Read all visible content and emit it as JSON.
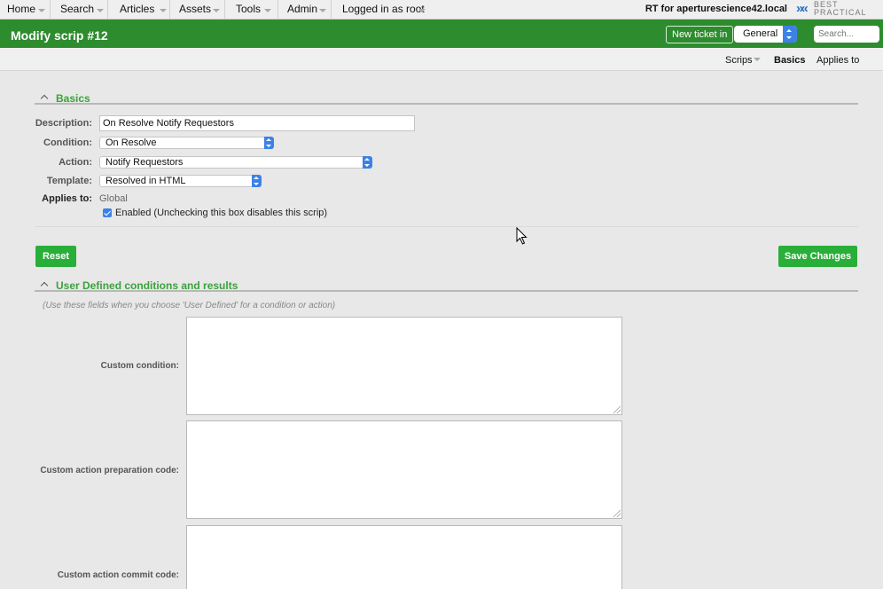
{
  "topbar": {
    "menu": [
      {
        "label": "Home"
      },
      {
        "label": "Search"
      },
      {
        "label": "Articles"
      },
      {
        "label": "Assets"
      },
      {
        "label": "Tools"
      },
      {
        "label": "Admin"
      },
      {
        "label": "Logged in as root"
      }
    ],
    "rt_for": "RT for aperturescience42.local",
    "logo_line1": "BEST",
    "logo_line2": "PRACTICAL"
  },
  "header": {
    "title": "Modify scrip #12",
    "new_ticket_label": "New ticket in",
    "queue_value": "General",
    "search_placeholder": "Search..."
  },
  "subnav": {
    "scrips": "Scrips",
    "basics": "Basics",
    "applies_to": "Applies to"
  },
  "basics": {
    "section_title": "Basics",
    "description_label": "Description:",
    "description_value": "On Resolve Notify Requestors",
    "condition_label": "Condition:",
    "condition_value": "On Resolve",
    "action_label": "Action:",
    "action_value": "Notify Requestors",
    "template_label": "Template:",
    "template_value": "Resolved in HTML",
    "applies_label": "Applies to:",
    "applies_value": "Global",
    "enabled_label": "Enabled (Unchecking this box disables this scrip)",
    "enabled_checked": true
  },
  "buttons": {
    "reset": "Reset",
    "save": "Save Changes"
  },
  "user_defined": {
    "section_title": "User Defined conditions and results",
    "hint": "(Use these fields when you choose 'User Defined' for a condition or action)",
    "custom_condition_label": "Custom condition:",
    "custom_prep_label": "Custom action preparation code:",
    "custom_commit_label": "Custom action commit code:"
  },
  "colors": {
    "header_green": "#2d8c2d",
    "button_green": "#2aae3a",
    "section_green": "#3aa33a",
    "select_blue": "#3c82e6"
  }
}
